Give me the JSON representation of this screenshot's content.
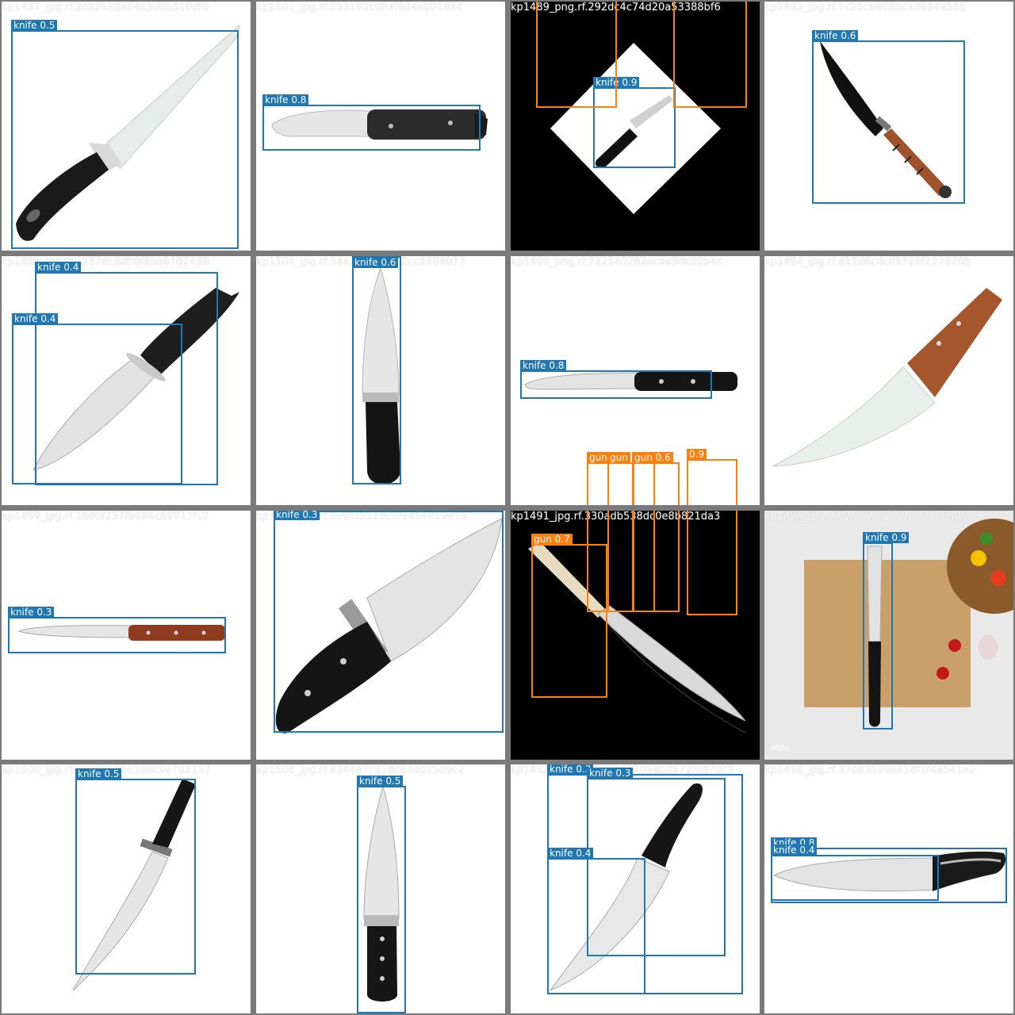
{
  "colors": {
    "knife": "#1f77b4",
    "gun": "#ff7f0e",
    "label_text": "#ffffff"
  },
  "tiles": [
    {
      "file": "kp1497_jpg.rf.2cd263de6463d05310df9",
      "scene": "chef-knife-diagonal",
      "detections": [
        {
          "class": "knife",
          "conf": "0.5"
        }
      ]
    },
    {
      "file": "kp1501_jpg.rf.353192c0fcff8d4e001444",
      "scene": "hunting-knife-horizontal",
      "detections": [
        {
          "class": "knife",
          "conf": "0.8"
        }
      ]
    },
    {
      "file": "kp1489_png.rf.292dc4c74d20a53388bf6",
      "scene": "paring-knife-rotated",
      "detections": [
        {
          "class": "knife",
          "conf": "0.9"
        },
        {
          "class": "",
          "conf": ""
        },
        {
          "class": "",
          "conf": ""
        }
      ]
    },
    {
      "file": "kp1493_jpg.rf.7c2bc6066bc1d664e55b",
      "scene": "combat-knife-diagonal",
      "detections": [
        {
          "class": "knife",
          "conf": "0.6"
        }
      ]
    },
    {
      "file": "kp1498_jpg.rf.1237dc3db0f8be6702499",
      "scene": "bowie-knife-guard",
      "detections": [
        {
          "class": "knife",
          "conf": "0.4"
        },
        {
          "class": "knife",
          "conf": "0.4"
        }
      ]
    },
    {
      "file": "kp1504_jpg.rf.34e76463b7b0cc6604077",
      "scene": "chef-knife-vertical",
      "detections": [
        {
          "class": "knife",
          "conf": "0.6"
        }
      ]
    },
    {
      "file": "kp1490_png.rf.732540282ecee9dc02b4c",
      "scene": "utility-knife-horizontal",
      "detections": [
        {
          "class": "knife",
          "conf": "0.8"
        },
        {
          "class": "gun",
          "conf": ""
        },
        {
          "class": "gun",
          "conf": ""
        },
        {
          "class": "gun",
          "conf": "0.6"
        },
        {
          "class": "",
          "conf": "0.9"
        }
      ]
    },
    {
      "file": "kp1494_jpg.rf.d12d0cdcd5726f127879b",
      "scene": "santoku-knife-wood",
      "detections": []
    },
    {
      "file": "kp1499_jpg.rf.26d0f237fb696c69913fc2",
      "scene": "steak-knife-horizontal",
      "detections": [
        {
          "class": "knife",
          "conf": "0.3"
        }
      ]
    },
    {
      "file": "kp1503_jpg.rf.6b07f5118c0fe454419e73",
      "scene": "bowie-knife-large",
      "detections": [
        {
          "class": "knife",
          "conf": "0.3"
        }
      ]
    },
    {
      "file": "kp1491_jpg.rf.330adb538dc0e8b821da3",
      "scene": "deba-knife-dark",
      "detections": [
        {
          "class": "gun",
          "conf": "0.7"
        }
      ]
    },
    {
      "file": "kp1495_jpg.rf.076a56c10670e83ef7affc",
      "scene": "knife-cutting-board",
      "detections": [
        {
          "class": "knife",
          "conf": "0.9"
        }
      ]
    },
    {
      "file": "kp1500_jpg.rf.589ea19be2eec9e7d2257",
      "scene": "survival-knife-vertical",
      "detections": [
        {
          "class": "knife",
          "conf": "0.5"
        }
      ]
    },
    {
      "file": "kp1506_jpg.rf.8344e7c918c84d075d9c2",
      "scene": "chef-knife-vertical-2",
      "detections": [
        {
          "class": "knife",
          "conf": "0.5"
        }
      ]
    },
    {
      "file": "kp1492_jpg.rf.0f7a1ae17b98bd672fe87bc3",
      "scene": "chef-knife-black-handle",
      "detections": [
        {
          "class": "knife",
          "conf": "0.3"
        },
        {
          "class": "knife",
          "conf": "0.3"
        },
        {
          "class": "knife",
          "conf": "0.4"
        }
      ]
    },
    {
      "file": "kp1496_jpg.rf.37d83699ee58f1f4a541e2",
      "scene": "chef-knife-horizontal",
      "detections": [
        {
          "class": "knife",
          "conf": "0.8"
        },
        {
          "class": "knife",
          "conf": "0.4"
        }
      ]
    }
  ],
  "watermark_text": "MINI"
}
